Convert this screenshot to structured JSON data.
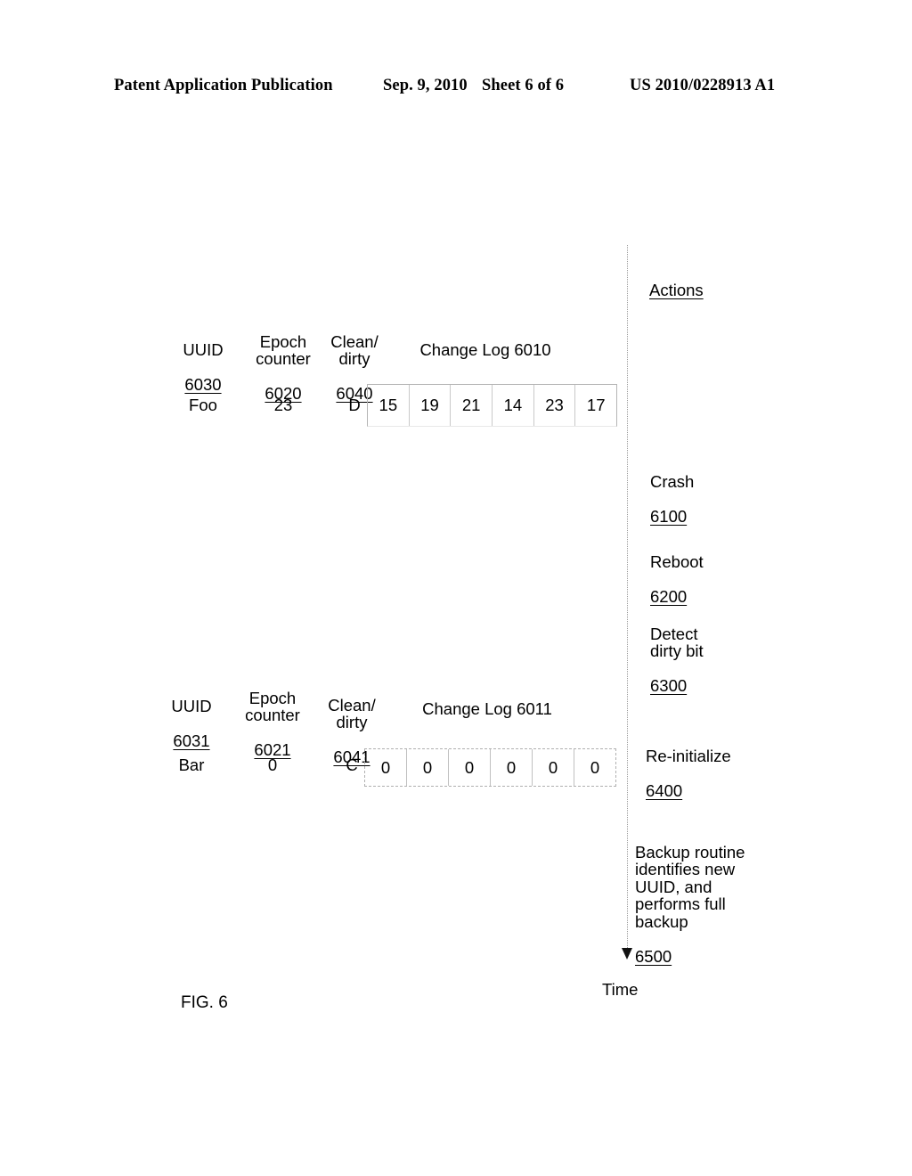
{
  "header": {
    "publication": "Patent Application Publication",
    "date": "Sep. 9, 2010",
    "sheet": "Sheet 6 of 6",
    "patent_number": "US 2010/0228913 A1"
  },
  "figure": {
    "caption": "FIG. 6",
    "timeline_label": "Time",
    "actions_title": "Actions"
  },
  "actions": [
    {
      "label": "Crash",
      "ref": "6100"
    },
    {
      "label": "Reboot",
      "ref": "6200"
    },
    {
      "label": "Detect\ndirty bit",
      "ref": "6300"
    },
    {
      "label": "Re-initialize",
      "ref": "6400"
    },
    {
      "label": "Backup routine\nidentifies new\nUUID, and\nperforms full\nbackup",
      "ref": "6500"
    }
  ],
  "records": [
    {
      "headers": {
        "uuid": "UUID",
        "uuid_ref": "6030",
        "epoch": "Epoch\ncounter",
        "epoch_ref": "6020",
        "flag": "Clean/\ndirty",
        "flag_ref": "6040",
        "changelog": "Change Log 6010"
      },
      "values": {
        "uuid": "Foo",
        "epoch": "23",
        "flag": "D"
      },
      "changelog_cells": [
        "15",
        "19",
        "21",
        "14",
        "23",
        "17"
      ]
    },
    {
      "headers": {
        "uuid": "UUID",
        "uuid_ref": "6031",
        "epoch": "Epoch\ncounter",
        "epoch_ref": "6021",
        "flag": "Clean/\ndirty",
        "flag_ref": "6041",
        "changelog": "Change Log 6011"
      },
      "values": {
        "uuid": "Bar",
        "epoch": "0",
        "flag": "C"
      },
      "changelog_cells": [
        "0",
        "0",
        "0",
        "0",
        "0",
        "0"
      ]
    }
  ],
  "colors": {
    "ink": "#000000",
    "paper": "#ffffff",
    "rule": "#b4b4b4"
  }
}
